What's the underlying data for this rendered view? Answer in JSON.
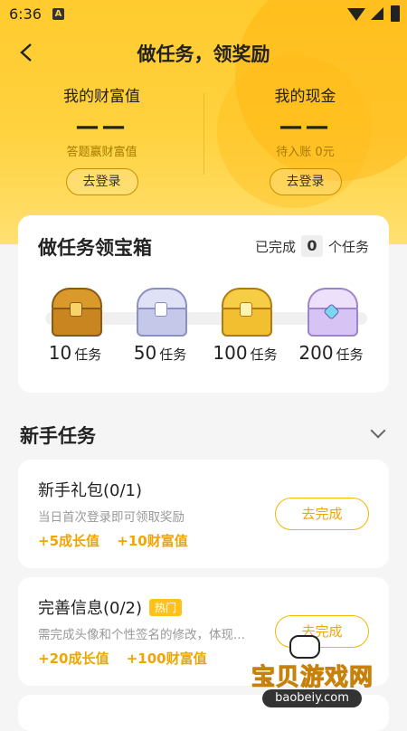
{
  "status": {
    "time": "6:36",
    "badge": "A"
  },
  "header": {
    "title": "做任务，领奖励"
  },
  "stats": [
    {
      "label": "我的财富值",
      "value": "——",
      "sub": "答题赢财富值",
      "button": "去登录"
    },
    {
      "label": "我的现金",
      "value": "——",
      "sub": "待入账 0元",
      "button": "去登录"
    }
  ],
  "chests": {
    "title": "做任务领宝箱",
    "done_prefix": "已完成",
    "done_count": "0",
    "done_suffix": "个任务",
    "items": [
      {
        "count": "10",
        "unit": "任务",
        "icon": "gold-chest-icon",
        "color": "#e0a030"
      },
      {
        "count": "50",
        "unit": "任务",
        "icon": "silver-chest-icon",
        "color": "#c5c8e8"
      },
      {
        "count": "100",
        "unit": "任务",
        "icon": "golden-chest-icon",
        "color": "#f2bf30"
      },
      {
        "count": "200",
        "unit": "任务",
        "icon": "diamond-chest-icon",
        "color": "#d8c4f4"
      }
    ]
  },
  "newbie": {
    "title": "新手任务",
    "tasks": [
      {
        "name": "新手礼包(0/1)",
        "badge": "",
        "desc": "当日首次登录即可领取奖励",
        "reward1": "+5成长值",
        "reward2": "+10财富值",
        "button": "去完成"
      },
      {
        "name": "完善信息(0/2)",
        "badge": "热门",
        "desc": "需完成头像和个性签名的修改，体现...",
        "reward1": "+20成长值",
        "reward2": "+100财富值",
        "button": "去完成"
      }
    ]
  },
  "watermark": {
    "text": "宝贝游戏网",
    "url": "baobeiy.com"
  },
  "colors": {
    "accent": "#ffd23f",
    "reward": "#f0a500",
    "button_border": "#f5b800"
  }
}
